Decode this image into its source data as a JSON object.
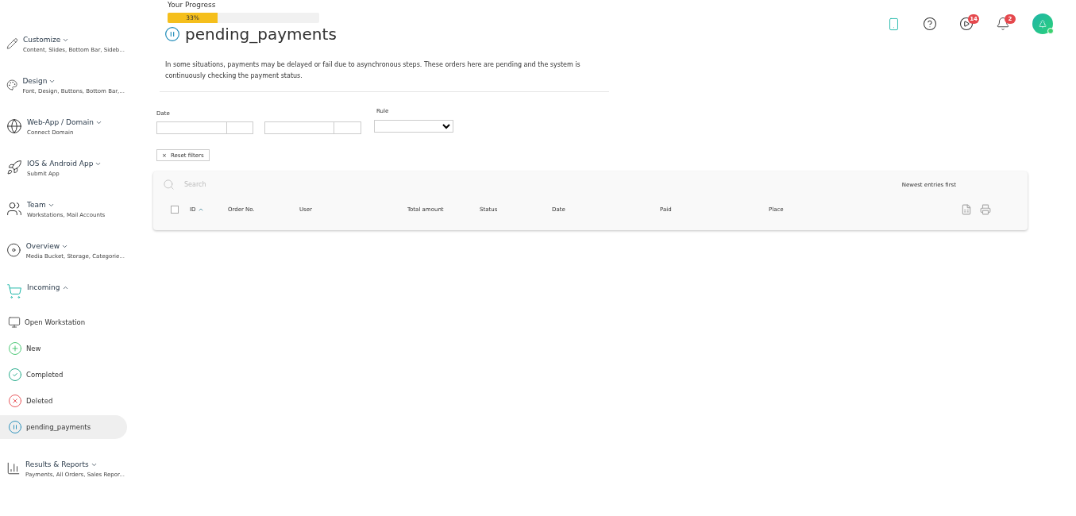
{
  "sidebar": {
    "items": [
      {
        "kind": "group",
        "title": "Customize",
        "subtitle": "Content, Slides, Bottom Bar, Sideb...",
        "expanded": false
      },
      {
        "kind": "group",
        "title": "Design",
        "subtitle": "Font, Design, Buttons, Bottom Bar,...",
        "expanded": false
      },
      {
        "kind": "group",
        "title": "Web-App / Domain",
        "subtitle": "Connect Domain",
        "expanded": false
      },
      {
        "kind": "group",
        "title": "IOS & Android App",
        "subtitle": "Submit App",
        "expanded": false
      },
      {
        "kind": "group",
        "title": "Team",
        "subtitle": "Workstations, Mail Accounts",
        "expanded": false
      },
      {
        "kind": "group",
        "title": "Overview",
        "subtitle": "Media Bucket, Storage, Categorie...",
        "expanded": false
      },
      {
        "kind": "group",
        "title": "Incoming",
        "expanded": true,
        "children": [
          {
            "label": "Open Workstation",
            "selected": false
          },
          {
            "label": "New",
            "selected": false
          },
          {
            "label": "Completed",
            "selected": false
          },
          {
            "label": "Deleted",
            "selected": false
          },
          {
            "label": "pending_payments",
            "selected": true
          }
        ]
      },
      {
        "kind": "group",
        "title": "Results & Reports",
        "subtitle": "Payments, All Orders, Sales Repor...",
        "expanded": false
      }
    ]
  },
  "progress": {
    "label": "Your Progress",
    "level": 0.33,
    "reading": "33%"
  },
  "page": {
    "title": "pending_payments",
    "description": "In some situations, payments may be delayed or fail due to asynchronous steps. These orders here are pending and the system is continuously checking the payment status."
  },
  "filters": {
    "date_label": "Date",
    "rule_label": "Rule",
    "reset": "Reset filters",
    "reset_icon": "×"
  },
  "header": {
    "video_badge": "14",
    "notification_badge": "2"
  },
  "table": {
    "search_placeholder": "Search",
    "sort": "Newest entries first",
    "select_all_checked": false,
    "columns": [
      {
        "label": "ID",
        "sorted": true
      },
      {
        "label": "Order No.",
        "sorted": false
      },
      {
        "label": "User",
        "sorted": false
      },
      {
        "label": "Total amount",
        "sorted": false
      },
      {
        "label": "Status",
        "sorted": false
      },
      {
        "label": "Date",
        "sorted": false
      },
      {
        "label": "Paid",
        "sorted": false
      },
      {
        "label": "Place",
        "sorted": false
      }
    ]
  }
}
